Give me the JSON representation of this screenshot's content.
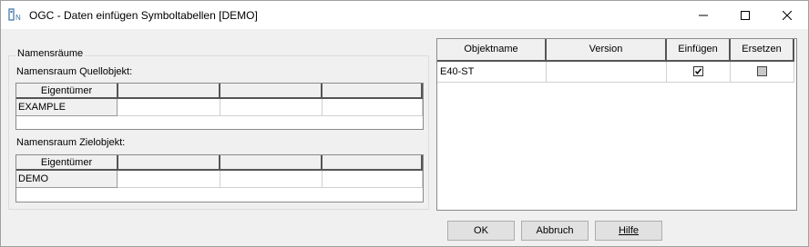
{
  "window": {
    "title": "OGC - Daten einfügen Symboltabellen [DEMO]",
    "app_icon": "ogc-app-icon",
    "controls": [
      "minimize-icon",
      "maximize-icon",
      "close-icon"
    ]
  },
  "namespaces": {
    "group_label": "Namensräume",
    "source": {
      "label": "Namensraum Quellobjekt:",
      "headers": [
        "Eigentümer",
        "",
        "",
        ""
      ],
      "rows": [
        [
          "EXAMPLE",
          "",
          "",
          ""
        ]
      ]
    },
    "target": {
      "label": "Namensraum Zielobjekt:",
      "headers": [
        "Eigentümer",
        "",
        "",
        ""
      ],
      "rows": [
        [
          "DEMO",
          "",
          "",
          ""
        ]
      ]
    }
  },
  "objects": {
    "headers": [
      "Objektname",
      "Version",
      "Einfügen",
      "Ersetzen"
    ],
    "rows": [
      {
        "name": "E40-ST",
        "version": "",
        "insert": "checked",
        "replace": "indeterminate"
      }
    ]
  },
  "buttons": {
    "ok": "OK",
    "cancel": "Abbruch",
    "help": "Hilfe"
  },
  "colors": {
    "window_bg": "#f0f0f0",
    "grid_border": "#555555"
  }
}
